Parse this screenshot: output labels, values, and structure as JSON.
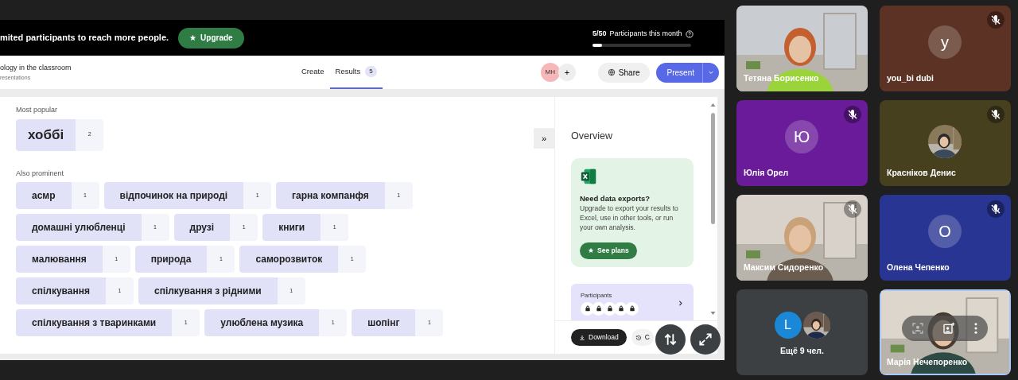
{
  "shared_screen": {
    "banner": {
      "text": "mited participants to reach more people.",
      "upgrade_button": "Upgrade",
      "count": "5/50",
      "count_label": "Participants this month",
      "level": 0.1
    },
    "header": {
      "title": "ology in the classroom",
      "subtitle": "resentations",
      "tabs": [
        {
          "label": "Create",
          "selected": false
        },
        {
          "label": "Results",
          "selected": true,
          "badge": "5"
        }
      ],
      "avatar": "MH",
      "add_button": "+",
      "share_button": "Share",
      "present_button": "Present"
    },
    "results": {
      "most_popular_label": "Most popular",
      "most_popular": [
        {
          "word": "хоббі",
          "count": "2"
        }
      ],
      "also_label": "Also prominent",
      "also": [
        [
          {
            "word": "асмр",
            "count": "1"
          },
          {
            "word": "відпочинок на природі",
            "count": "1"
          },
          {
            "word": "гарна компанфя",
            "count": "1"
          }
        ],
        [
          {
            "word": "домашні улюбленці",
            "count": "1"
          },
          {
            "word": "друзі",
            "count": "1"
          },
          {
            "word": "книги",
            "count": "1"
          }
        ],
        [
          {
            "word": "малювання",
            "count": "1"
          },
          {
            "word": "природа",
            "count": "1"
          },
          {
            "word": "саморозвиток",
            "count": "1"
          }
        ],
        [
          {
            "word": "спілкування",
            "count": "1"
          },
          {
            "word": "спілкування з рідними",
            "count": "1"
          }
        ],
        [
          {
            "word": "спілкування з тваринками",
            "count": "1"
          },
          {
            "word": "улюблена музика",
            "count": "1"
          },
          {
            "word": "шопінг",
            "count": "1"
          }
        ]
      ]
    },
    "collapse_button": "»",
    "overview": {
      "title": "Overview",
      "promo": {
        "title": "Need data exports?",
        "text": "Upgrade to export your results to Excel, use in other tools, or run your own analysis.",
        "button": "See plans"
      },
      "participants_label": "Participants",
      "download_button": "Download",
      "second_button": "C"
    }
  },
  "participants": [
    {
      "kind": "video",
      "name": "Тетяна Борисенко",
      "muted": false,
      "highlighted": false
    },
    {
      "kind": "avatar",
      "name": "you_bi dubi",
      "letter": "у",
      "muted": true,
      "highlighted": false,
      "color": "#5c3224"
    },
    {
      "kind": "avatar",
      "name": "Юлія Орел",
      "letter": "Ю",
      "muted": true,
      "highlighted": false,
      "color": "#6a1b9a"
    },
    {
      "kind": "photo_avatar",
      "name": "Красніков Денис",
      "muted": true,
      "highlighted": false,
      "color": "#47401f"
    },
    {
      "kind": "video",
      "name": "Максим Сидоренко",
      "muted": true,
      "highlighted": false
    },
    {
      "kind": "avatar",
      "name": "Олена Чепенко",
      "letter": "О",
      "muted": true,
      "highlighted": false,
      "color": "#283593"
    },
    {
      "kind": "more",
      "label": "Ещё 9 чел.",
      "letter": "L"
    },
    {
      "kind": "video",
      "name": "Марія Нечепоренко",
      "muted": false,
      "highlighted": true
    }
  ]
}
